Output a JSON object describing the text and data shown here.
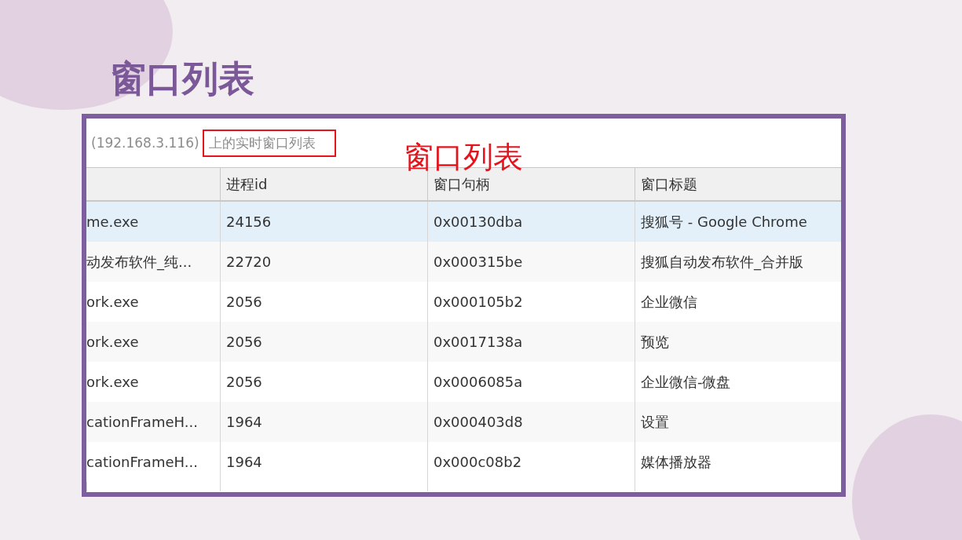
{
  "slide_title": "窗口列表",
  "panel": {
    "caption_prefix": "(192.168.3.116)",
    "caption_highlighted": "上的实时窗口列表",
    "annotation": "窗口列表"
  },
  "table": {
    "columns": [
      "",
      "进程id",
      "窗口句柄",
      "窗口标题"
    ],
    "rows": [
      {
        "cells": [
          "me.exe",
          "24156",
          "0x00130dba",
          "搜狐号 - Google Chrome"
        ],
        "selected": true
      },
      {
        "cells": [
          "动发布软件_纯...",
          "22720",
          "0x000315be",
          "搜狐自动发布软件_合并版"
        ],
        "selected": false
      },
      {
        "cells": [
          "ork.exe",
          "2056",
          "0x000105b2",
          "企业微信"
        ],
        "selected": false
      },
      {
        "cells": [
          "ork.exe",
          "2056",
          "0x0017138a",
          "预览"
        ],
        "selected": false
      },
      {
        "cells": [
          "ork.exe",
          "2056",
          "0x0006085a",
          "企业微信-微盘"
        ],
        "selected": false
      },
      {
        "cells": [
          "cationFrameH...",
          "1964",
          "0x000403d8",
          "设置"
        ],
        "selected": false
      },
      {
        "cells": [
          "cationFrameH...",
          "1964",
          "0x000c08b2",
          "媒体播放器"
        ],
        "selected": false
      }
    ]
  }
}
